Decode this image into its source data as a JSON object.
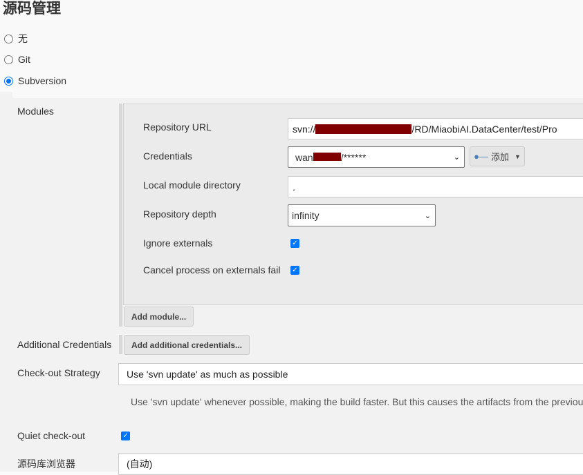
{
  "title": "源码管理",
  "scm_options": [
    {
      "label": "无",
      "selected": false
    },
    {
      "label": "Git",
      "selected": false
    },
    {
      "label": "Subversion",
      "selected": true
    }
  ],
  "modules": {
    "label": "Modules",
    "repository_url_label": "Repository URL",
    "repository_url_prefix": "svn://",
    "repository_url_suffix": "/RD/MiaobiAI.DataCenter/test/Pro",
    "credentials_label": "Credentials",
    "credentials_prefix": "wan",
    "credentials_suffix": "/******",
    "add_label": "添加",
    "local_dir_label": "Local module directory",
    "local_dir_value": ".",
    "depth_label": "Repository depth",
    "depth_value": "infinity",
    "ignore_externals_label": "Ignore externals",
    "ignore_externals": true,
    "cancel_externals_label": "Cancel process on externals fail",
    "cancel_externals": true,
    "add_module_label": "Add module..."
  },
  "additional_credentials": {
    "label": "Additional Credentials",
    "button": "Add additional credentials..."
  },
  "checkout": {
    "label": "Check-out Strategy",
    "value": "Use 'svn update' as much as possible",
    "help": "Use 'svn update' whenever possible, making the build faster. But this causes the artifacts from the previous"
  },
  "quiet": {
    "label": "Quiet check-out",
    "checked": true
  },
  "browser": {
    "label": "源码库浏览器",
    "value": "(自动)"
  },
  "colors": {
    "accent": "#0075ff",
    "redaction": "#800000"
  }
}
